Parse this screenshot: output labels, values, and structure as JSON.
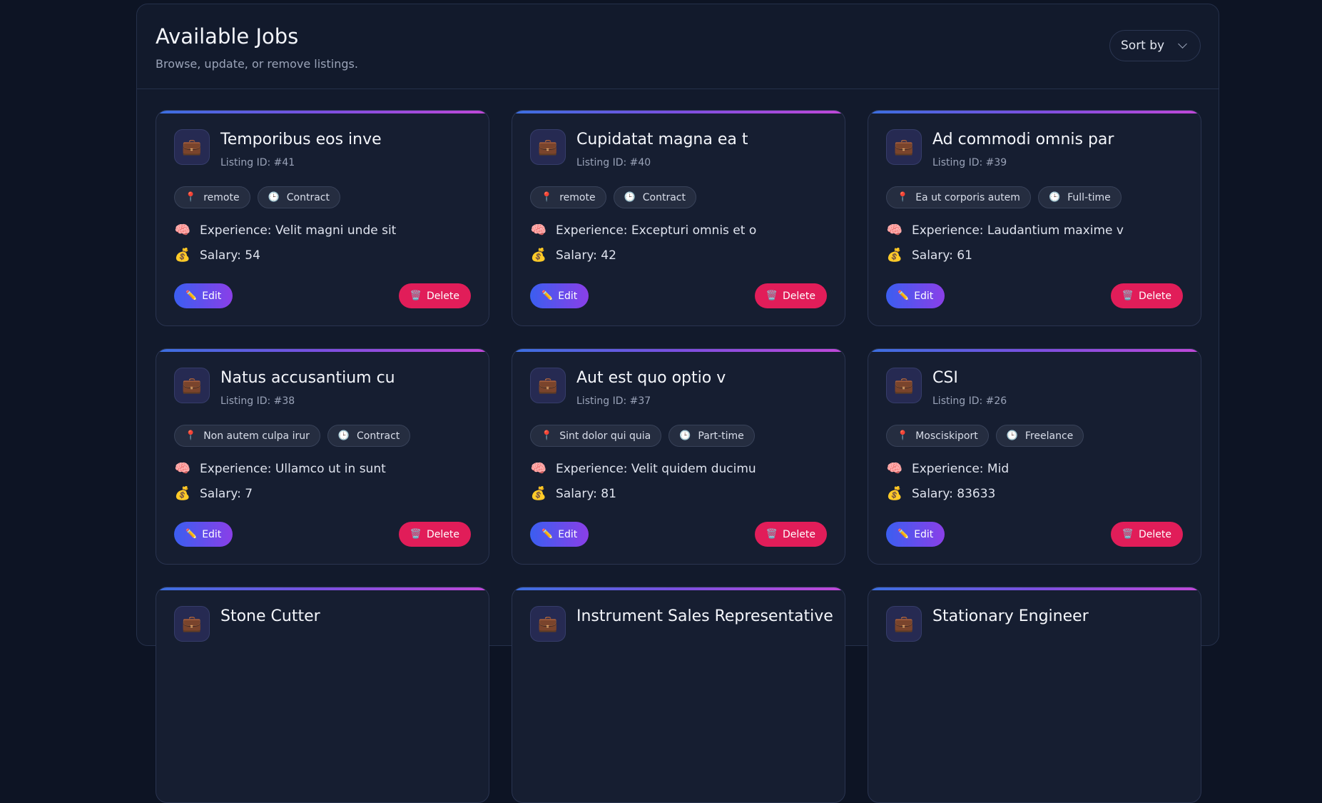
{
  "header": {
    "title": "Available Jobs",
    "subtitle": "Browse, update, or remove listings.",
    "sort_label": "Sort by"
  },
  "labels": {
    "edit": "Edit",
    "delete": "Delete"
  },
  "jobs": [
    {
      "title": "Temporibus eos inve",
      "listing_id": "Listing ID: #41",
      "location": "remote",
      "type": "Contract",
      "experience": "Experience: Velit magni unde sit",
      "salary": "Salary: 54"
    },
    {
      "title": "Cupidatat magna ea t",
      "listing_id": "Listing ID: #40",
      "location": "remote",
      "type": "Contract",
      "experience": "Experience: Excepturi omnis et o",
      "salary": "Salary: 42"
    },
    {
      "title": "Ad commodi omnis par",
      "listing_id": "Listing ID: #39",
      "location": "Ea ut corporis autem",
      "type": "Full-time",
      "experience": "Experience: Laudantium maxime v",
      "salary": "Salary: 61"
    },
    {
      "title": "Natus accusantium cu",
      "listing_id": "Listing ID: #38",
      "location": "Non autem culpa irur",
      "type": "Contract",
      "experience": "Experience: Ullamco ut in sunt",
      "salary": "Salary: 7"
    },
    {
      "title": "Aut est quo optio v",
      "listing_id": "Listing ID: #37",
      "location": "Sint dolor qui quia",
      "type": "Part-time",
      "experience": "Experience: Velit quidem ducimu",
      "salary": "Salary: 81"
    },
    {
      "title": "CSI",
      "listing_id": "Listing ID: #26",
      "location": "Mosciskiport",
      "type": "Freelance",
      "experience": "Experience: Mid",
      "salary": "Salary: 83633"
    },
    {
      "title": "Stone Cutter",
      "listing_id": "",
      "location": "",
      "type": "",
      "experience": "",
      "salary": ""
    },
    {
      "title": "Instrument Sales Representative",
      "listing_id": "",
      "location": "",
      "type": "",
      "experience": "",
      "salary": ""
    },
    {
      "title": "Stationary Engineer",
      "listing_id": "",
      "location": "",
      "type": "",
      "experience": "",
      "salary": ""
    }
  ],
  "icons": {
    "job": "briefcase-icon",
    "location": "pin-icon",
    "type": "clock-icon",
    "experience": "brain-icon",
    "salary": "money-bag-icon",
    "edit": "pencil-icon",
    "delete": "trash-icon"
  },
  "colors": {
    "background": "#0d1424",
    "card": "#161e31",
    "edit_gradient_start": "#3b5ef0",
    "edit_gradient_end": "#8a3fe8",
    "delete": "#e11d59"
  }
}
